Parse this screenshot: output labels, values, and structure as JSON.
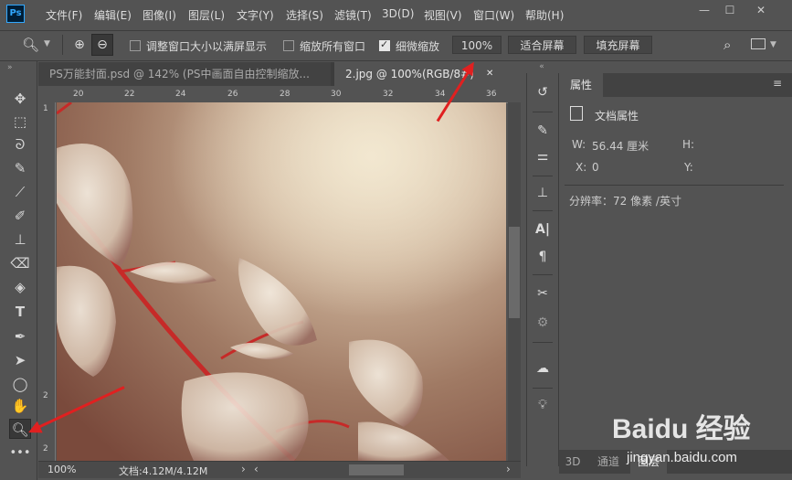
{
  "app": {
    "logo": "Ps"
  },
  "menu": [
    "文件(F)",
    "编辑(E)",
    "图像(I)",
    "图层(L)",
    "文字(Y)",
    "选择(S)",
    "滤镜(T)",
    "3D(D)",
    "视图(V)",
    "窗口(W)",
    "帮助(H)"
  ],
  "window_controls": {
    "minimize": "—",
    "restore": "☐",
    "close": "✕"
  },
  "options_bar": {
    "resize_windows_label": "调整窗口大小以满屏显示",
    "resize_windows_checked": false,
    "zoom_all_label": "缩放所有窗口",
    "zoom_all_checked": false,
    "scrubby_zoom_label": "细微缩放",
    "scrubby_zoom_checked": true,
    "zoom_value": "100%",
    "fit_screen_label": "适合屏幕",
    "fill_screen_label": "填充屏幕"
  },
  "tabs": [
    {
      "label": "PS万能封面.psd @ 142% (PS中画面自由控制缩放...",
      "close": "✕",
      "active": false
    },
    {
      "label": "2.jpg @ 100%(RGB/8#)",
      "close": "✕",
      "active": true
    }
  ],
  "ruler": {
    "top": [
      "20",
      "22",
      "24",
      "26",
      "28",
      "30",
      "32",
      "34",
      "36"
    ],
    "left": [
      "1",
      "2",
      "2"
    ]
  },
  "status": {
    "zoom": "100%",
    "doc_info": "文档:4.12M/4.12M"
  },
  "properties": {
    "tab_label": "属性",
    "section_title": "文档属性",
    "w_label": "W:",
    "w_value": "56.44 厘米",
    "h_label": "H:",
    "x_label": "X:",
    "x_value": "0",
    "y_label": "Y:",
    "resolution": "分辨率：72 像素 /英寸"
  },
  "bottom_tabs": [
    "3D",
    "通道",
    "图层"
  ],
  "watermark": {
    "brand": "Baidu 经验",
    "url": "jingyan.baidu.com"
  },
  "colors": {
    "accent_arrow": "#e02020",
    "panel": "#535353",
    "dark": "#3c3c3c",
    "ps_blue": "#31a8ff"
  }
}
